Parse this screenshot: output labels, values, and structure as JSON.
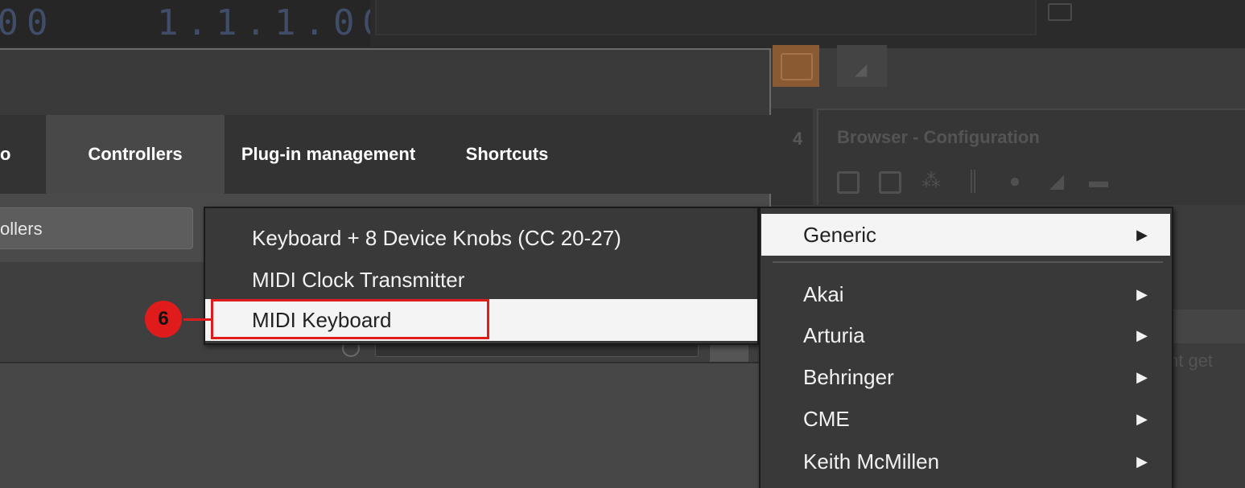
{
  "transport": {
    "time_a": ".00",
    "time_b": "1.1.1.00"
  },
  "background": {
    "panel_number": "4",
    "browser_title": "Browser - Configuration",
    "browser_icons": [
      "square-icon",
      "plugin-icon",
      "waveform-icon",
      "mixer-icon",
      "disc-icon",
      "folder-icon",
      "monitor-icon"
    ],
    "right_partial_text": "nt get"
  },
  "preferences": {
    "tabs": [
      {
        "label": "o"
      },
      {
        "label": "Controllers",
        "selected": true
      },
      {
        "label": "Plug-in management"
      },
      {
        "label": "Shortcuts"
      }
    ],
    "add_controller_button": "ollers"
  },
  "menu_main": {
    "items": [
      {
        "label": "Keyboard + 8 Device Knobs (CC 20-27)"
      },
      {
        "label": "MIDI Clock Transmitter"
      },
      {
        "label": "MIDI Keyboard",
        "highlighted": true
      }
    ]
  },
  "menu_vendors": {
    "items": [
      {
        "label": "Generic",
        "arrow": "▶",
        "highlighted": true
      },
      {
        "label": "Akai",
        "arrow": "▶"
      },
      {
        "label": "Arturia",
        "arrow": "▶"
      },
      {
        "label": "Behringer",
        "arrow": "▶"
      },
      {
        "label": "CME",
        "arrow": "▶"
      },
      {
        "label": "Keith McMillen",
        "arrow": "▶"
      }
    ]
  },
  "annotation": {
    "step_number": "6",
    "color": "#e01b1b"
  }
}
